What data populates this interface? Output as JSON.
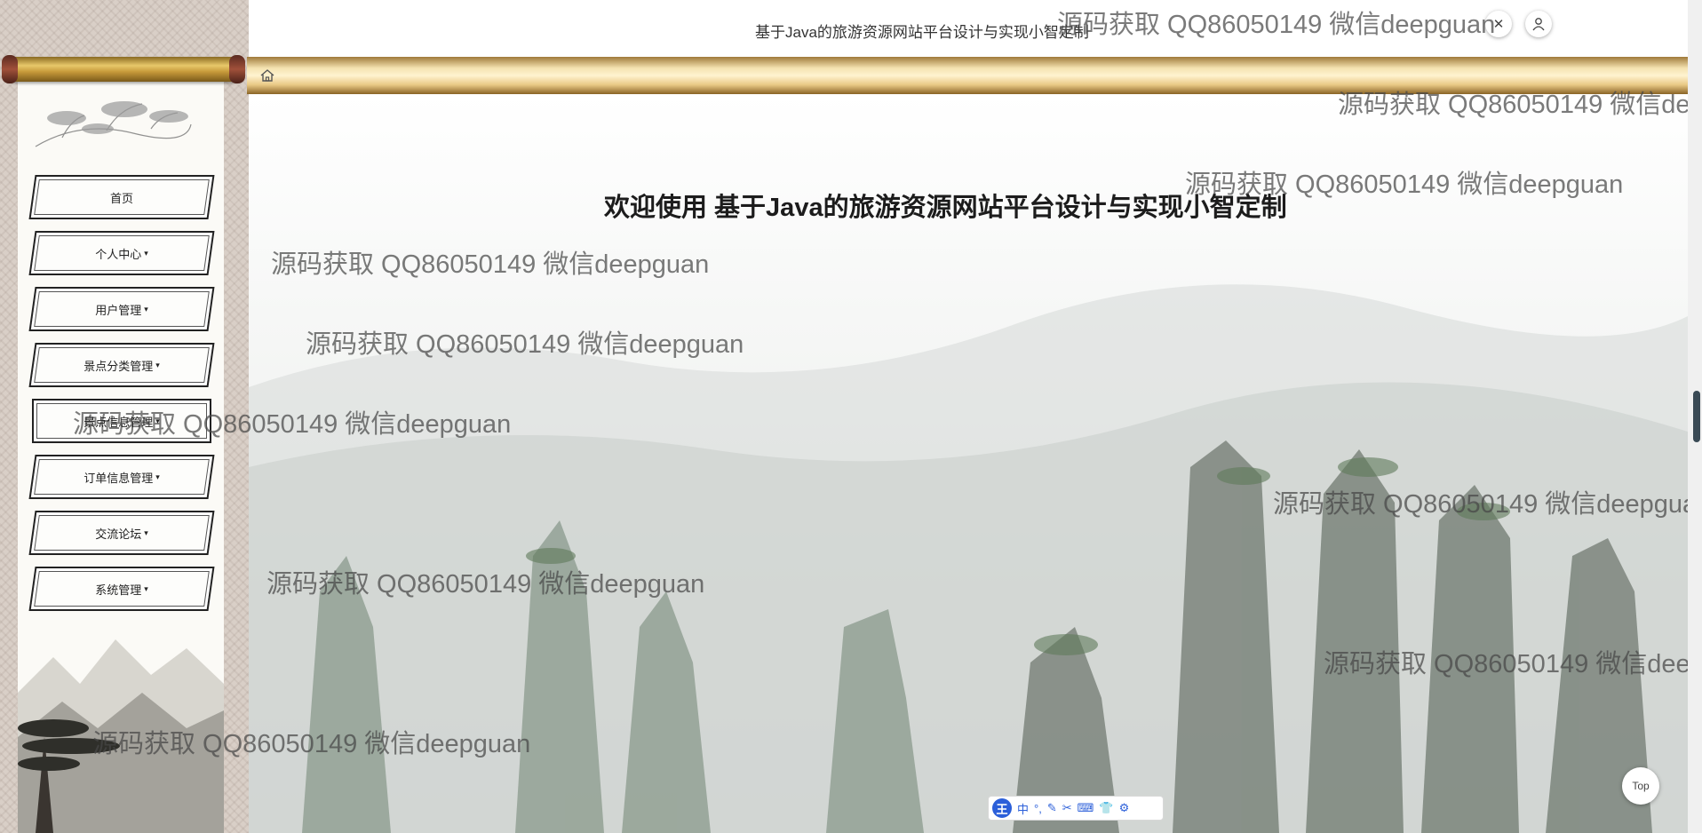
{
  "header": {
    "title": "基于Java的旅游资源网站平台设计与实现小智定制",
    "close_icon": "close-icon",
    "user_icon": "user-icon"
  },
  "breadcrumb": {
    "home_icon": "home-icon"
  },
  "sidebar": {
    "items": [
      {
        "label": "首页",
        "caret": ""
      },
      {
        "label": "个人中心",
        "caret": "▾"
      },
      {
        "label": "用户管理",
        "caret": "▾"
      },
      {
        "label": "景点分类管理",
        "caret": "▾"
      },
      {
        "label": "景点信息管理",
        "caret": "▾"
      },
      {
        "label": "订单信息管理",
        "caret": "▾"
      },
      {
        "label": "交流论坛",
        "caret": "▾"
      },
      {
        "label": "系统管理",
        "caret": "▾"
      }
    ]
  },
  "main": {
    "welcome": "欢迎使用 基于Java的旅游资源网站平台设计与实现小智定制"
  },
  "watermark": {
    "text": "源码获取 QQ86050149 微信deepguan"
  },
  "top_button": {
    "label": "Top"
  },
  "ime": {
    "logo": "王",
    "items": [
      "中",
      "°,",
      "✎",
      "✂",
      "⌨",
      "👕",
      "⚙"
    ]
  },
  "colors": {
    "gold": "#e8c86a",
    "sidebar_bg": "#d9cfc7",
    "ime_blue": "#2b5fd9"
  }
}
